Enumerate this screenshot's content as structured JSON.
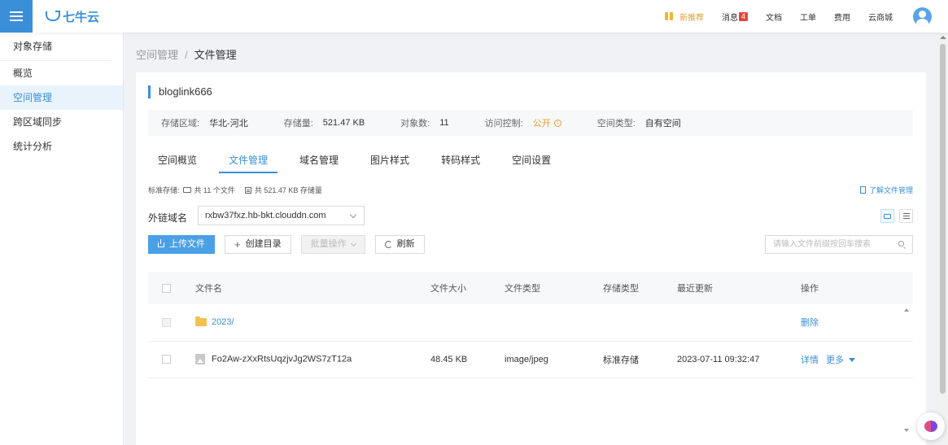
{
  "topbar": {
    "brand": "七牛云",
    "nav": {
      "promo": "新推荐",
      "messages": "消息",
      "messages_badge": "4",
      "docs": "文档",
      "tickets": "工单",
      "billing": "费用",
      "marketplace": "云商城"
    }
  },
  "sidebar": {
    "title": "对象存储",
    "items": [
      "概览",
      "空间管理",
      "跨区域同步",
      "统计分析"
    ]
  },
  "breadcrumb": {
    "parent": "空间管理",
    "separator": "/",
    "current": "文件管理"
  },
  "bucket": {
    "name": "bloglink666",
    "info": {
      "region_label": "存储区域:",
      "region": "华北-河北",
      "storage_label": "存储量:",
      "storage": "521.47 KB",
      "objects_label": "对象数:",
      "objects": "11",
      "access_label": "访问控制:",
      "access": "公开",
      "type_label": "空间类型:",
      "type": "自有空间"
    }
  },
  "tabs": [
    "空间概览",
    "文件管理",
    "域名管理",
    "图片样式",
    "转码样式",
    "空间设置"
  ],
  "stats": {
    "prefix": "标准存储:",
    "files": "共 11 个文件",
    "size": "共 521.47 KB 存储量"
  },
  "help_link": "了解文件管理",
  "domain": {
    "label": "外链域名",
    "value": "rxbw37fxz.hb-bkt.clouddn.com"
  },
  "toolbar": {
    "upload": "上传文件",
    "mkdir": "创建目录",
    "batch": "批量操作",
    "refresh": "刷新"
  },
  "search": {
    "placeholder": "请输入文件前缀按回车搜索"
  },
  "table": {
    "headers": [
      "文件名",
      "文件大小",
      "文件类型",
      "存储类型",
      "最近更新",
      "操作"
    ],
    "rows": [
      {
        "name": "2023/",
        "size": "",
        "type": "",
        "storage": "",
        "updated": "",
        "actions": [
          "删除"
        ]
      },
      {
        "name": "Fo2Aw-zXxRtsUqzjvJg2WS7zT12a",
        "size": "48.45 KB",
        "type": "image/jpeg",
        "storage": "标准存储",
        "updated": "2023-07-11 09:32:47",
        "actions": [
          "详情",
          "更多"
        ]
      }
    ]
  },
  "colors": {
    "primary": "#3a8fd9",
    "warning": "#e0a133",
    "badge": "#e4473e"
  }
}
